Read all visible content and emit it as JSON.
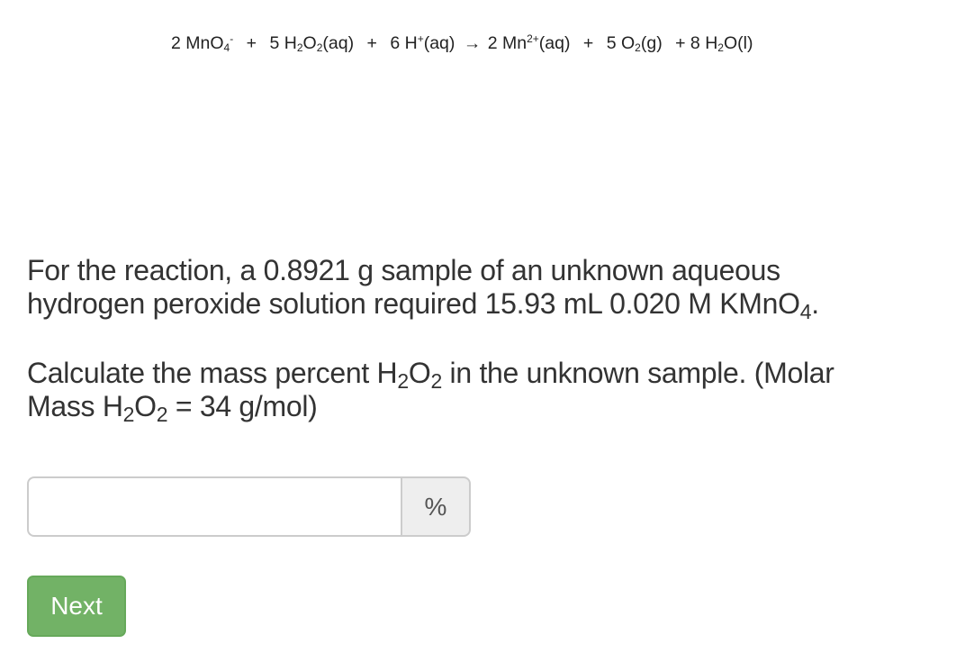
{
  "equation": {
    "reactant1_coef": "2",
    "reactant1_base": "MnO",
    "reactant1_sub": "4",
    "reactant1_sup": "-",
    "plus": "+",
    "reactant2_coef": "5",
    "reactant2_a": "H",
    "reactant2_sub1": "2",
    "reactant2_b": "O",
    "reactant2_sub2": "2",
    "reactant2_state": "(aq)",
    "reactant3_coef": "6",
    "reactant3_base": "H",
    "reactant3_sup": "+",
    "reactant3_state": "(aq)",
    "arrow": "→",
    "product1_coef": "2",
    "product1_base": "Mn",
    "product1_sup": "2+",
    "product1_state": "(aq)",
    "product2_coef": "5",
    "product2_base": "O",
    "product2_sub": "2",
    "product2_state": "(g)",
    "product3_prefix": "+ 8",
    "product3_a": "H",
    "product3_sub": "2",
    "product3_b": "O(l)"
  },
  "question": {
    "paragraph1_line1": "For the reaction, a 0.8921 g sample of an unknown aqueous",
    "paragraph1_line2_text": "hydrogen peroxide solution required 15.93 mL 0.020 M KMnO",
    "paragraph1_line2_sub": "4",
    "paragraph1_line2_end": ".",
    "paragraph2_part1": "Calculate the mass percent H",
    "paragraph2_sub1": "2",
    "paragraph2_part2": "O",
    "paragraph2_sub2": "2",
    "paragraph2_part3": " in the unknown sample. (Molar",
    "paragraph2_line2_part1": "Mass H",
    "paragraph2_line2_sub1": "2",
    "paragraph2_line2_part2": "O",
    "paragraph2_line2_sub2": "2",
    "paragraph2_line2_part3": " = 34 g/mol)"
  },
  "answer": {
    "value": "",
    "placeholder": "",
    "unit_addon": "%"
  },
  "buttons": {
    "next_label": "Next"
  },
  "colors": {
    "next_button_bg": "#72b266",
    "addon_bg": "#eeeeee",
    "border": "#cccccc"
  }
}
